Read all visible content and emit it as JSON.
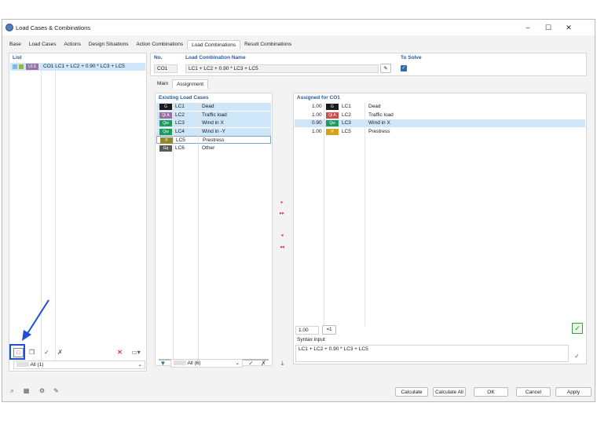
{
  "window": {
    "title": "Load Cases & Combinations",
    "controls": [
      "–",
      "☐",
      "✕"
    ]
  },
  "tabs": [
    "Base",
    "Load Cases",
    "Actions",
    "Design Situations",
    "Action Combinations",
    "Load Combinations",
    "Result Combinations"
  ],
  "active_tab": "Load Combinations",
  "list": {
    "header": "List",
    "items": [
      {
        "badge": "ULS",
        "label": "CO1  LC1 + LC2 + 0.90 * LC3 + LC5"
      }
    ],
    "filter": "All (1)"
  },
  "no": {
    "label": "No.",
    "value": "CO1"
  },
  "name": {
    "label": "Load Combination Name",
    "value": "LC1 + LC2 + 0.90 * LC3 + LC5"
  },
  "to_solve": {
    "label": "To Solve",
    "checked": true
  },
  "subtabs": [
    "Main",
    "Assignment"
  ],
  "active_subtab": "Assignment",
  "existing": {
    "header": "Existing Load Cases",
    "rows": [
      {
        "badge": "G",
        "color": "#1b1b1b",
        "lc": "LC1",
        "desc": "Dead"
      },
      {
        "badge": "Qi A",
        "color": "#9a6fa3",
        "lc": "LC2",
        "desc": "Traffic load"
      },
      {
        "badge": "Qw",
        "color": "#1c9c5c",
        "lc": "LC3",
        "desc": "Wind in X"
      },
      {
        "badge": "Qw",
        "color": "#1c9c5c",
        "lc": "LC4",
        "desc": "Wind in -Y"
      },
      {
        "badge": "P",
        "color": "#8f8a2a",
        "lc": "LC5",
        "desc": "Prestress"
      },
      {
        "badge": "Gq",
        "color": "#5b5b5b",
        "lc": "LC6",
        "desc": "Other"
      }
    ],
    "filter": "All (6)"
  },
  "assigned": {
    "header": "Assigned for CO1",
    "rows": [
      {
        "factor": "1.00",
        "badge": "G",
        "color": "#1b1b1b",
        "lc": "LC1",
        "desc": "Dead"
      },
      {
        "factor": "1.00",
        "badge": "Qi A",
        "color": "#d24a4a",
        "lc": "LC2",
        "desc": "Traffic load"
      },
      {
        "factor": "0.90",
        "badge": "Qw",
        "color": "#1c9c5c",
        "lc": "LC3",
        "desc": "Wind in X"
      },
      {
        "factor": "1.00",
        "badge": "P",
        "color": "#d5a21c",
        "lc": "LC5",
        "desc": "Prestress"
      }
    ],
    "factor_input": "1.00",
    "factor_apply": "=1"
  },
  "syntax": {
    "label": "Syntax input",
    "value": "LC1 + LC2 + 0.90 * LC3 + LC5"
  },
  "buttons": {
    "calculate": "Calculate",
    "calculate_all": "Calculate All",
    "ok": "OK",
    "cancel": "Cancel",
    "apply": "Apply"
  },
  "arrows": {
    "add": "▸",
    "add_all": "▸▸",
    "remove": "◂",
    "remove_all": "◂◂"
  },
  "accent": "#2b6cb0",
  "annotation_color": "#1f4fd8"
}
